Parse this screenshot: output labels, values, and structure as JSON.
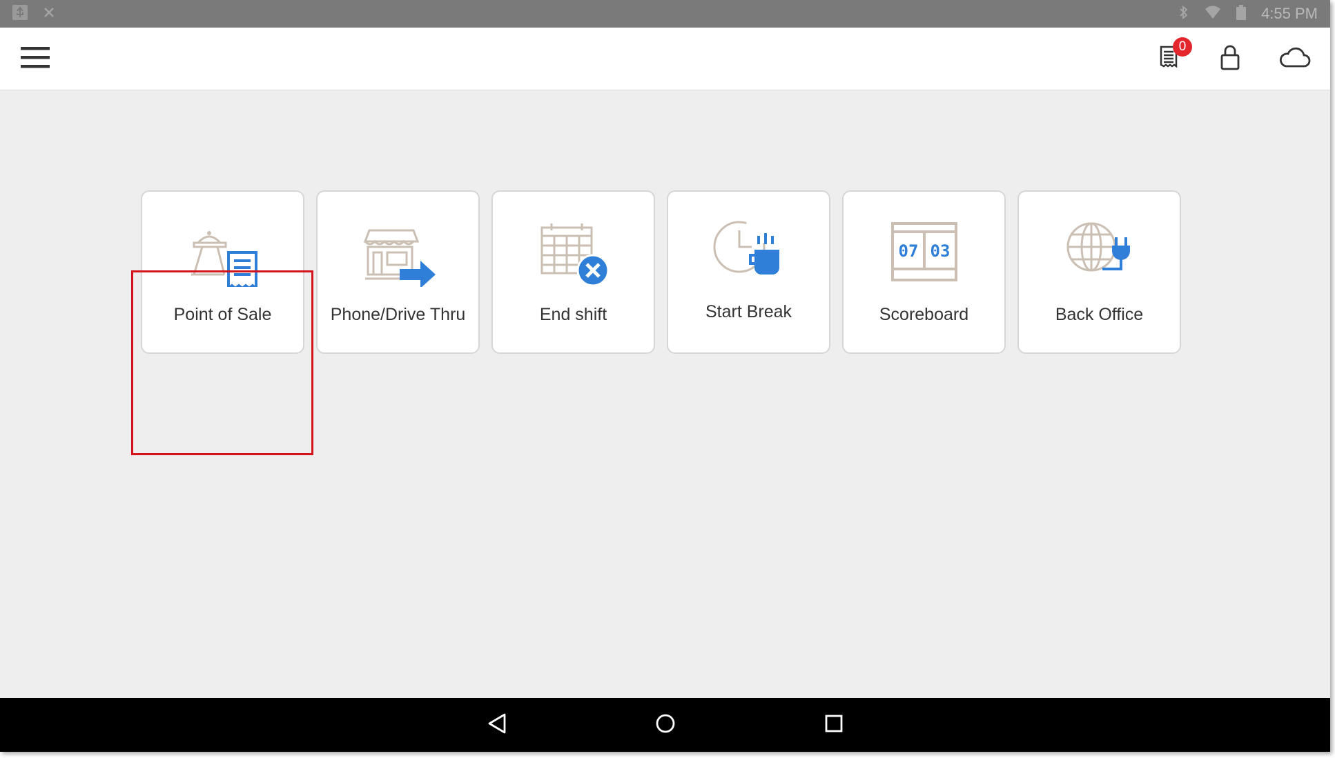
{
  "status_bar": {
    "time": "4:55 PM",
    "left_icons": [
      "usb-icon",
      "close-icon"
    ],
    "right_icons": [
      "bluetooth-icon",
      "wifi-icon",
      "battery-icon"
    ]
  },
  "app_bar": {
    "menu_icon": "menu-icon",
    "orders_badge": "0",
    "actions": [
      "receipt-icon",
      "lock-icon",
      "cloud-icon"
    ]
  },
  "tiles": [
    {
      "label": "Point of Sale",
      "icon": "point-of-sale-icon",
      "selected": true
    },
    {
      "label": "Phone/Drive Thru",
      "icon": "storefront-arrow-icon"
    },
    {
      "label": "End shift",
      "icon": "calendar-cancel-icon"
    },
    {
      "label": "Start Break",
      "icon": "clock-coffee-icon"
    },
    {
      "label": "Scoreboard",
      "icon": "scoreboard-icon",
      "score_left": "07",
      "score_right": "03"
    },
    {
      "label": "Back Office",
      "icon": "globe-plug-icon"
    }
  ],
  "nav_bar": {
    "buttons": [
      "back-icon",
      "home-icon",
      "recents-icon"
    ]
  },
  "colors": {
    "accent": "#2f7fd8",
    "icon_tan": "#cbbfb3",
    "highlight": "#d4141c",
    "badge": "#e4262d"
  }
}
